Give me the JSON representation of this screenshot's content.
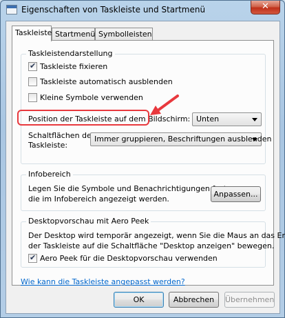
{
  "window": {
    "title": "Eigenschaften von Taskleiste und Startmenü",
    "close_label": "✕"
  },
  "tabs": [
    {
      "label": "Taskleiste",
      "active": true
    },
    {
      "label": "Startmenü",
      "active": false
    },
    {
      "label": "Symbolleisten",
      "active": false
    }
  ],
  "appearance": {
    "title": "Taskleistendarstellung",
    "fix_taskbar": {
      "label": "Taskleiste fixieren",
      "checked": true
    },
    "auto_hide": {
      "label": "Taskleiste automatisch ausblenden",
      "checked": false
    },
    "small_icons": {
      "label": "Kleine Symbole verwenden",
      "checked": false
    },
    "position_label": "Position der Taskleiste auf dem Bildschirm:",
    "position_value": "Unten",
    "buttons_label_line1": "Schaltflächen der",
    "buttons_label_line2": "Taskleiste:",
    "buttons_value": "Immer gruppieren, Beschriftungen ausblenden"
  },
  "notification_area": {
    "title": "Infobereich",
    "text_line1": "Legen Sie die Symbole und Benachrichtigungen fest,",
    "text_line2": "die im Infobereich angezeigt werden.",
    "customize_label": "Anpassen..."
  },
  "aero_peek": {
    "title": "Desktopvorschau mit Aero Peek",
    "text_line1": "Der Desktop wird temporär angezeigt, wenn Sie die Maus an das Ende",
    "text_line2": "der Taskleiste auf die Schaltfläche \"Desktop anzeigen\" bewegen.",
    "use_peek": {
      "label": "Aero Peek für die Desktopvorschau verwenden",
      "checked": true
    }
  },
  "help_link": "Wie kann die Taskleiste angepasst werden?",
  "footer": {
    "ok_label": "OK",
    "cancel_label": "Abbrechen",
    "apply_label": "Übernehmen"
  },
  "colors": {
    "highlight": "#e8383d",
    "link": "#0066cc"
  }
}
